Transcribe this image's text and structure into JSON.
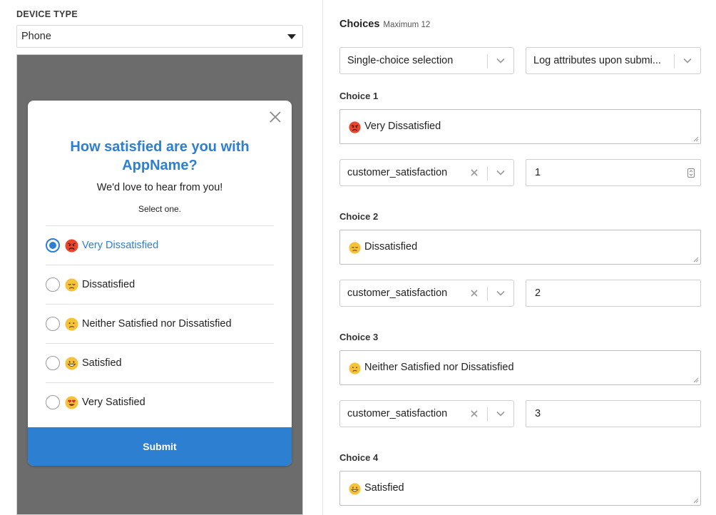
{
  "device": {
    "label": "DEVICE TYPE",
    "value": "Phone"
  },
  "preview": {
    "title": "How satisfied are you with AppName?",
    "subtitle": "We'd love to hear from you!",
    "hint": "Select one.",
    "options": [
      {
        "label": "Very Dissatisfied",
        "emoji": "angry-face-icon",
        "selected": true
      },
      {
        "label": "Dissatisfied",
        "emoji": "disappointed-face-icon",
        "selected": false
      },
      {
        "label": "Neither Satisfied nor Dissatisfied",
        "emoji": "confused-face-icon",
        "selected": false
      },
      {
        "label": "Satisfied",
        "emoji": "grinning-face-icon",
        "selected": false
      },
      {
        "label": "Very Satisfied",
        "emoji": "heart-eyes-face-icon",
        "selected": false
      }
    ],
    "submit_label": "Submit"
  },
  "choices": {
    "title": "Choices",
    "max_label": "Maximum 12",
    "selection_mode": "Single-choice selection",
    "log_mode": "Log attributes upon submi...",
    "items": [
      {
        "label": "Choice 1",
        "text": "Very Dissatisfied",
        "emoji": "angry-face-icon",
        "attribute": "customer_satisfaction",
        "value": "1"
      },
      {
        "label": "Choice 2",
        "text": "Dissatisfied",
        "emoji": "disappointed-face-icon",
        "attribute": "customer_satisfaction",
        "value": "2"
      },
      {
        "label": "Choice 3",
        "text": "Neither Satisfied nor Dissatisfied",
        "emoji": "confused-face-icon",
        "attribute": "customer_satisfaction",
        "value": "3"
      },
      {
        "label": "Choice 4",
        "text": "Satisfied",
        "emoji": "grinning-face-icon"
      }
    ]
  },
  "colors": {
    "accent": "#2d7fd1",
    "preview_bg": "#6c6c6c"
  }
}
